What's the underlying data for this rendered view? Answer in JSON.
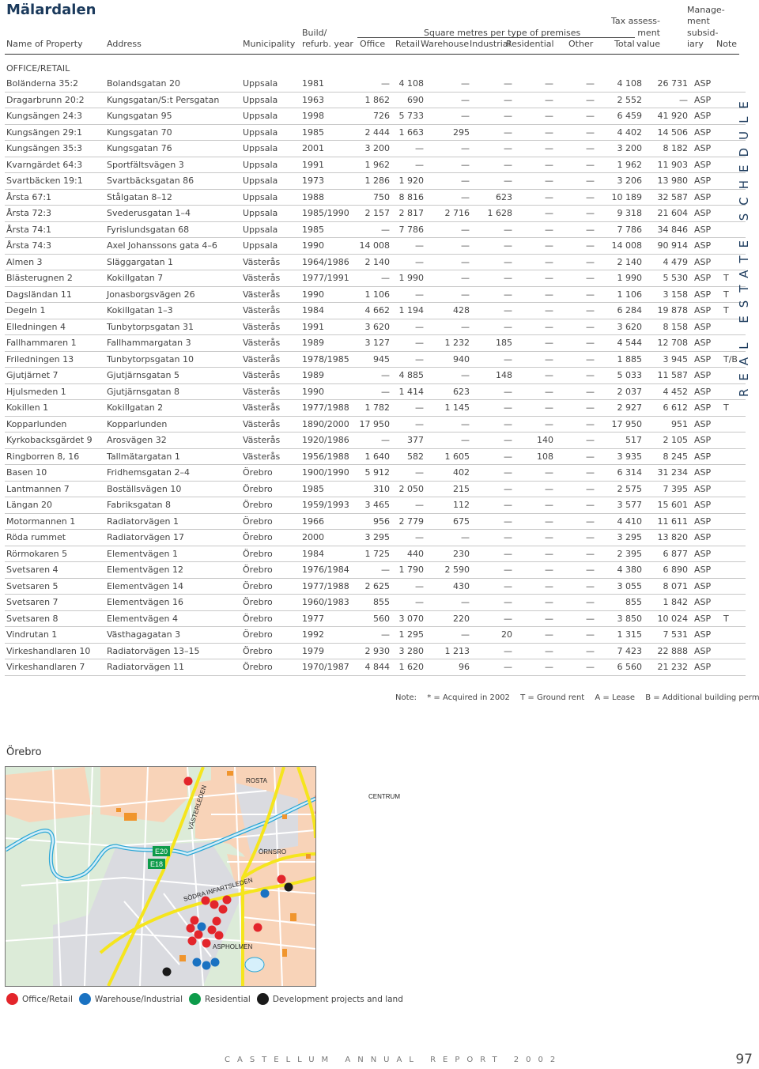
{
  "region_title": "Mälardalen",
  "side_label": "REAL ESTATE SCHEDULE",
  "headers": {
    "name": "Name of Property",
    "address": "Address",
    "municipality": "Municipality",
    "year_line1": "Build/",
    "year_line2": "refurb. year",
    "sqm_group": "Square metres per type of premises",
    "office": "Office",
    "retail": "Retail",
    "warehouse": "Warehouse",
    "industrial": "Industrial",
    "residential": "Residential",
    "other": "Other",
    "total": "Total",
    "tax_line1": "Tax assess-",
    "tax_line2": "ment",
    "tax_line3": "value",
    "mgmt_line1": "Manage-",
    "mgmt_line2": "ment",
    "mgmt_line3": "subsid-",
    "mgmt_line4": "iary",
    "note": "Note"
  },
  "section_label": "OFFICE/RETAIL",
  "rows": [
    {
      "name": "Boländerna 35:2",
      "address": "Bolandsgatan 20",
      "municipality": "Uppsala",
      "year": "1981",
      "office": "—",
      "retail": "4 108",
      "warehouse": "—",
      "industrial": "—",
      "residential": "—",
      "other": "—",
      "total": "4 108",
      "tax": "26 731",
      "mgmt": "ASP",
      "note": ""
    },
    {
      "name": "Dragarbrunn 20:2",
      "address": "Kungsgatan/S:t Persgatan",
      "municipality": "Uppsala",
      "year": "1963",
      "office": "1 862",
      "retail": "690",
      "warehouse": "—",
      "industrial": "—",
      "residential": "—",
      "other": "—",
      "total": "2 552",
      "tax": "—",
      "mgmt": "ASP",
      "note": ""
    },
    {
      "name": "Kungsängen 24:3",
      "address": "Kungsgatan 95",
      "municipality": "Uppsala",
      "year": "1998",
      "office": "726",
      "retail": "5 733",
      "warehouse": "—",
      "industrial": "—",
      "residential": "—",
      "other": "—",
      "total": "6 459",
      "tax": "41 920",
      "mgmt": "ASP",
      "note": ""
    },
    {
      "name": "Kungsängen 29:1",
      "address": "Kungsgatan 70",
      "municipality": "Uppsala",
      "year": "1985",
      "office": "2 444",
      "retail": "1 663",
      "warehouse": "295",
      "industrial": "—",
      "residential": "—",
      "other": "—",
      "total": "4 402",
      "tax": "14 506",
      "mgmt": "ASP",
      "note": ""
    },
    {
      "name": "Kungsängen 35:3",
      "address": "Kungsgatan 76",
      "municipality": "Uppsala",
      "year": "2001",
      "office": "3 200",
      "retail": "—",
      "warehouse": "—",
      "industrial": "—",
      "residential": "—",
      "other": "—",
      "total": "3 200",
      "tax": "8 182",
      "mgmt": "ASP",
      "note": ""
    },
    {
      "name": "Kvarngärdet 64:3",
      "address": "Sportfältsvägen 3",
      "municipality": "Uppsala",
      "year": "1991",
      "office": "1 962",
      "retail": "—",
      "warehouse": "—",
      "industrial": "—",
      "residential": "—",
      "other": "—",
      "total": "1 962",
      "tax": "11 903",
      "mgmt": "ASP",
      "note": ""
    },
    {
      "name": "Svartbäcken 19:1",
      "address": "Svartbäcksgatan 86",
      "municipality": "Uppsala",
      "year": "1973",
      "office": "1 286",
      "retail": "1 920",
      "warehouse": "—",
      "industrial": "—",
      "residential": "—",
      "other": "—",
      "total": "3 206",
      "tax": "13 980",
      "mgmt": "ASP",
      "note": ""
    },
    {
      "name": "Årsta 67:1",
      "address": "Stålgatan 8–12",
      "municipality": "Uppsala",
      "year": "1988",
      "office": "750",
      "retail": "8 816",
      "warehouse": "—",
      "industrial": "623",
      "residential": "—",
      "other": "—",
      "total": "10 189",
      "tax": "32 587",
      "mgmt": "ASP",
      "note": ""
    },
    {
      "name": "Årsta 72:3",
      "address": "Svederusgatan 1–4",
      "municipality": "Uppsala",
      "year": "1985/1990",
      "office": "2 157",
      "retail": "2 817",
      "warehouse": "2 716",
      "industrial": "1 628",
      "residential": "—",
      "other": "—",
      "total": "9 318",
      "tax": "21 604",
      "mgmt": "ASP",
      "note": ""
    },
    {
      "name": "Årsta 74:1",
      "address": "Fyrislundsgatan 68",
      "municipality": "Uppsala",
      "year": "1985",
      "office": "—",
      "retail": "7 786",
      "warehouse": "—",
      "industrial": "—",
      "residential": "—",
      "other": "—",
      "total": "7 786",
      "tax": "34 846",
      "mgmt": "ASP",
      "note": ""
    },
    {
      "name": "Årsta 74:3",
      "address": "Axel Johanssons gata 4–6",
      "municipality": "Uppsala",
      "year": "1990",
      "office": "14 008",
      "retail": "—",
      "warehouse": "—",
      "industrial": "—",
      "residential": "—",
      "other": "—",
      "total": "14 008",
      "tax": "90 914",
      "mgmt": "ASP",
      "note": ""
    },
    {
      "name": "Almen 3",
      "address": "Släggargatan 1",
      "municipality": "Västerås",
      "year": "1964/1986",
      "office": "2 140",
      "retail": "—",
      "warehouse": "—",
      "industrial": "—",
      "residential": "—",
      "other": "—",
      "total": "2 140",
      "tax": "4 479",
      "mgmt": "ASP",
      "note": ""
    },
    {
      "name": "Blästerugnen 2",
      "address": "Kokillgatan 7",
      "municipality": "Västerås",
      "year": "1977/1991",
      "office": "—",
      "retail": "1 990",
      "warehouse": "—",
      "industrial": "—",
      "residential": "—",
      "other": "—",
      "total": "1 990",
      "tax": "5 530",
      "mgmt": "ASP",
      "note": "T"
    },
    {
      "name": "Dagsländan 11",
      "address": "Jonasborgsvägen 26",
      "municipality": "Västerås",
      "year": "1990",
      "office": "1 106",
      "retail": "—",
      "warehouse": "—",
      "industrial": "—",
      "residential": "—",
      "other": "—",
      "total": "1 106",
      "tax": "3 158",
      "mgmt": "ASP",
      "note": "T"
    },
    {
      "name": "Degeln 1",
      "address": "Kokillgatan 1–3",
      "municipality": "Västerås",
      "year": "1984",
      "office": "4 662",
      "retail": "1 194",
      "warehouse": "428",
      "industrial": "—",
      "residential": "—",
      "other": "—",
      "total": "6 284",
      "tax": "19 878",
      "mgmt": "ASP",
      "note": "T"
    },
    {
      "name": "Elledningen 4",
      "address": "Tunbytorpsgatan 31",
      "municipality": "Västerås",
      "year": "1991",
      "office": "3 620",
      "retail": "—",
      "warehouse": "—",
      "industrial": "—",
      "residential": "—",
      "other": "—",
      "total": "3 620",
      "tax": "8 158",
      "mgmt": "ASP",
      "note": ""
    },
    {
      "name": "Fallhammaren 1",
      "address": "Fallhammargatan 3",
      "municipality": "Västerås",
      "year": "1989",
      "office": "3 127",
      "retail": "—",
      "warehouse": "1 232",
      "industrial": "185",
      "residential": "—",
      "other": "—",
      "total": "4 544",
      "tax": "12 708",
      "mgmt": "ASP",
      "note": ""
    },
    {
      "name": "Friledningen 13",
      "address": "Tunbytorpsgatan 10",
      "municipality": "Västerås",
      "year": "1978/1985",
      "office": "945",
      "retail": "—",
      "warehouse": "940",
      "industrial": "—",
      "residential": "—",
      "other": "—",
      "total": "1 885",
      "tax": "3 945",
      "mgmt": "ASP",
      "note": "T/B"
    },
    {
      "name": "Gjutjärnet 7",
      "address": "Gjutjärnsgatan 5",
      "municipality": "Västerås",
      "year": "1989",
      "office": "—",
      "retail": "4 885",
      "warehouse": "—",
      "industrial": "148",
      "residential": "—",
      "other": "—",
      "total": "5 033",
      "tax": "11 587",
      "mgmt": "ASP",
      "note": ""
    },
    {
      "name": "Hjulsmeden 1",
      "address": "Gjutjärnsgatan 8",
      "municipality": "Västerås",
      "year": "1990",
      "office": "—",
      "retail": "1 414",
      "warehouse": "623",
      "industrial": "—",
      "residential": "—",
      "other": "—",
      "total": "2 037",
      "tax": "4 452",
      "mgmt": "ASP",
      "note": ""
    },
    {
      "name": "Kokillen 1",
      "address": "Kokillgatan 2",
      "municipality": "Västerås",
      "year": "1977/1988",
      "office": "1 782",
      "retail": "—",
      "warehouse": "1 145",
      "industrial": "—",
      "residential": "—",
      "other": "—",
      "total": "2 927",
      "tax": "6 612",
      "mgmt": "ASP",
      "note": "T"
    },
    {
      "name": "Kopparlunden",
      "address": "Kopparlunden",
      "municipality": "Västerås",
      "year": "1890/2000",
      "office": "17 950",
      "retail": "—",
      "warehouse": "—",
      "industrial": "—",
      "residential": "—",
      "other": "—",
      "total": "17 950",
      "tax": "951",
      "mgmt": "ASP",
      "note": ""
    },
    {
      "name": "Kyrkobacksgärdet 9",
      "address": "Arosvägen 32",
      "municipality": "Västerås",
      "year": "1920/1986",
      "office": "—",
      "retail": "377",
      "warehouse": "—",
      "industrial": "—",
      "residential": "140",
      "other": "—",
      "total": "517",
      "tax": "2 105",
      "mgmt": "ASP",
      "note": ""
    },
    {
      "name": "Ringborren 8, 16",
      "address": "Tallmätargatan 1",
      "municipality": "Västerås",
      "year": "1956/1988",
      "office": "1 640",
      "retail": "582",
      "warehouse": "1 605",
      "industrial": "—",
      "residential": "108",
      "other": "—",
      "total": "3 935",
      "tax": "8 245",
      "mgmt": "ASP",
      "note": ""
    },
    {
      "name": "Basen 10",
      "address": "Fridhemsgatan 2–4",
      "municipality": "Örebro",
      "year": "1900/1990",
      "office": "5 912",
      "retail": "—",
      "warehouse": "402",
      "industrial": "—",
      "residential": "—",
      "other": "—",
      "total": "6 314",
      "tax": "31 234",
      "mgmt": "ASP",
      "note": ""
    },
    {
      "name": "Lantmannen 7",
      "address": "Boställsvägen 10",
      "municipality": "Örebro",
      "year": "1985",
      "office": "310",
      "retail": "2 050",
      "warehouse": "215",
      "industrial": "—",
      "residential": "—",
      "other": "—",
      "total": "2 575",
      "tax": "7 395",
      "mgmt": "ASP",
      "note": ""
    },
    {
      "name": "Längan 20",
      "address": "Fabriksgatan 8",
      "municipality": "Örebro",
      "year": "1959/1993",
      "office": "3 465",
      "retail": "—",
      "warehouse": "112",
      "industrial": "—",
      "residential": "—",
      "other": "—",
      "total": "3 577",
      "tax": "15 601",
      "mgmt": "ASP",
      "note": ""
    },
    {
      "name": "Motormannen 1",
      "address": "Radiatorvägen 1",
      "municipality": "Örebro",
      "year": "1966",
      "office": "956",
      "retail": "2 779",
      "warehouse": "675",
      "industrial": "—",
      "residential": "—",
      "other": "—",
      "total": "4 410",
      "tax": "11 611",
      "mgmt": "ASP",
      "note": ""
    },
    {
      "name": "Röda rummet",
      "address": "Radiatorvägen 17",
      "municipality": "Örebro",
      "year": "2000",
      "office": "3 295",
      "retail": "—",
      "warehouse": "—",
      "industrial": "—",
      "residential": "—",
      "other": "—",
      "total": "3 295",
      "tax": "13 820",
      "mgmt": "ASP",
      "note": ""
    },
    {
      "name": "Rörmokaren 5",
      "address": "Elementvägen 1",
      "municipality": "Örebro",
      "year": "1984",
      "office": "1 725",
      "retail": "440",
      "warehouse": "230",
      "industrial": "—",
      "residential": "—",
      "other": "—",
      "total": "2 395",
      "tax": "6 877",
      "mgmt": "ASP",
      "note": ""
    },
    {
      "name": "Svetsaren 4",
      "address": "Elementvägen 12",
      "municipality": "Örebro",
      "year": "1976/1984",
      "office": "—",
      "retail": "1 790",
      "warehouse": "2 590",
      "industrial": "—",
      "residential": "—",
      "other": "—",
      "total": "4 380",
      "tax": "6 890",
      "mgmt": "ASP",
      "note": ""
    },
    {
      "name": "Svetsaren 5",
      "address": "Elementvägen 14",
      "municipality": "Örebro",
      "year": "1977/1988",
      "office": "2 625",
      "retail": "—",
      "warehouse": "430",
      "industrial": "—",
      "residential": "—",
      "other": "—",
      "total": "3 055",
      "tax": "8 071",
      "mgmt": "ASP",
      "note": ""
    },
    {
      "name": "Svetsaren 7",
      "address": "Elementvägen 16",
      "municipality": "Örebro",
      "year": "1960/1983",
      "office": "855",
      "retail": "—",
      "warehouse": "—",
      "industrial": "—",
      "residential": "—",
      "other": "—",
      "total": "855",
      "tax": "1 842",
      "mgmt": "ASP",
      "note": ""
    },
    {
      "name": "Svetsaren 8",
      "address": "Elementvägen 4",
      "municipality": "Örebro",
      "year": "1977",
      "office": "560",
      "retail": "3 070",
      "warehouse": "220",
      "industrial": "—",
      "residential": "—",
      "other": "—",
      "total": "3 850",
      "tax": "10 024",
      "mgmt": "ASP",
      "note": "T"
    },
    {
      "name": "Vindrutan 1",
      "address": "Västhagagatan 3",
      "municipality": "Örebro",
      "year": "1992",
      "office": "—",
      "retail": "1 295",
      "warehouse": "—",
      "industrial": "20",
      "residential": "—",
      "other": "—",
      "total": "1 315",
      "tax": "7 531",
      "mgmt": "ASP",
      "note": ""
    },
    {
      "name": "Virkeshandlaren 10",
      "address": "Radiatorvägen 13–15",
      "municipality": "Örebro",
      "year": "1979",
      "office": "2 930",
      "retail": "3 280",
      "warehouse": "1 213",
      "industrial": "—",
      "residential": "—",
      "other": "—",
      "total": "7 423",
      "tax": "22 888",
      "mgmt": "ASP",
      "note": ""
    },
    {
      "name": "Virkeshandlaren 7",
      "address": "Radiatorvägen 11",
      "municipality": "Örebro",
      "year": "1970/1987",
      "office": "4 844",
      "retail": "1 620",
      "warehouse": "96",
      "industrial": "—",
      "residential": "—",
      "other": "—",
      "total": "6 560",
      "tax": "21 232",
      "mgmt": "ASP",
      "note": ""
    }
  ],
  "notes": {
    "label": "Note:",
    "items": [
      "* = Acquired in 2002",
      "T = Ground rent",
      "A = Lease",
      "B = Additional building permission"
    ]
  },
  "map": {
    "title": "Örebro",
    "labels": {
      "rosta": "ROSTA",
      "centrum": "CENTRUM",
      "vasterleden": "VÄSTERLEDEN",
      "ornsro": "ÖRNSRO",
      "sodra": "SÖDRA INFARTSLEDEN",
      "aspholmen": "ASPHOLMEN",
      "e20": "E20",
      "e18": "E18"
    },
    "colors": {
      "office_retail": "#e3252b",
      "warehouse_industrial": "#1a72c2",
      "residential": "#0d9b4a",
      "development": "#1a1a1a",
      "road": "#f5e51d",
      "water": "#2aa6d6",
      "urban": "#f8d3b8",
      "green": "#dcebd8",
      "industrial_area": "#dadbe0"
    }
  },
  "legend": [
    {
      "label": "Office/Retail",
      "color": "#e3252b"
    },
    {
      "label": "Warehouse/Industrial",
      "color": "#1a72c2"
    },
    {
      "label": "Residential",
      "color": "#0d9b4a"
    },
    {
      "label": "Development projects and land",
      "color": "#1a1a1a"
    }
  ],
  "footer": {
    "report": "CASTELLUM ANNUAL REPORT 2002",
    "page": "97"
  }
}
